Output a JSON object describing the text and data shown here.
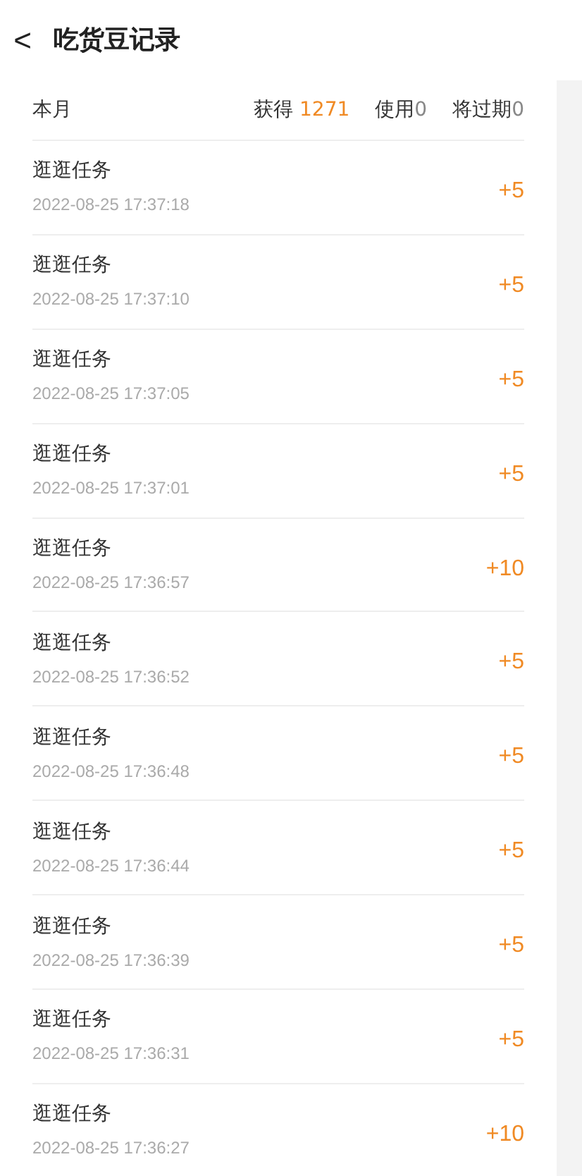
{
  "header": {
    "back": "<",
    "title": "吃货豆记录"
  },
  "summary": {
    "period": "本月",
    "earned_label": "获得",
    "earned": "1271",
    "used_label": "使用",
    "used": "0",
    "expiring_label": "将过期",
    "expiring": "0"
  },
  "records": [
    {
      "title": "逛逛任务",
      "time": "2022-08-25 17:37:18",
      "amount": "+5"
    },
    {
      "title": "逛逛任务",
      "time": "2022-08-25 17:37:10",
      "amount": "+5"
    },
    {
      "title": "逛逛任务",
      "time": "2022-08-25 17:37:05",
      "amount": "+5"
    },
    {
      "title": "逛逛任务",
      "time": "2022-08-25 17:37:01",
      "amount": "+5"
    },
    {
      "title": "逛逛任务",
      "time": "2022-08-25 17:36:57",
      "amount": "+10"
    },
    {
      "title": "逛逛任务",
      "time": "2022-08-25 17:36:52",
      "amount": "+5"
    },
    {
      "title": "逛逛任务",
      "time": "2022-08-25 17:36:48",
      "amount": "+5"
    },
    {
      "title": "逛逛任务",
      "time": "2022-08-25 17:36:44",
      "amount": "+5"
    },
    {
      "title": "逛逛任务",
      "time": "2022-08-25 17:36:39",
      "amount": "+5"
    },
    {
      "title": "逛逛任务",
      "time": "2022-08-25 17:36:31",
      "amount": "+5"
    },
    {
      "title": "逛逛任务",
      "time": "2022-08-25 17:36:27",
      "amount": "+10"
    }
  ]
}
